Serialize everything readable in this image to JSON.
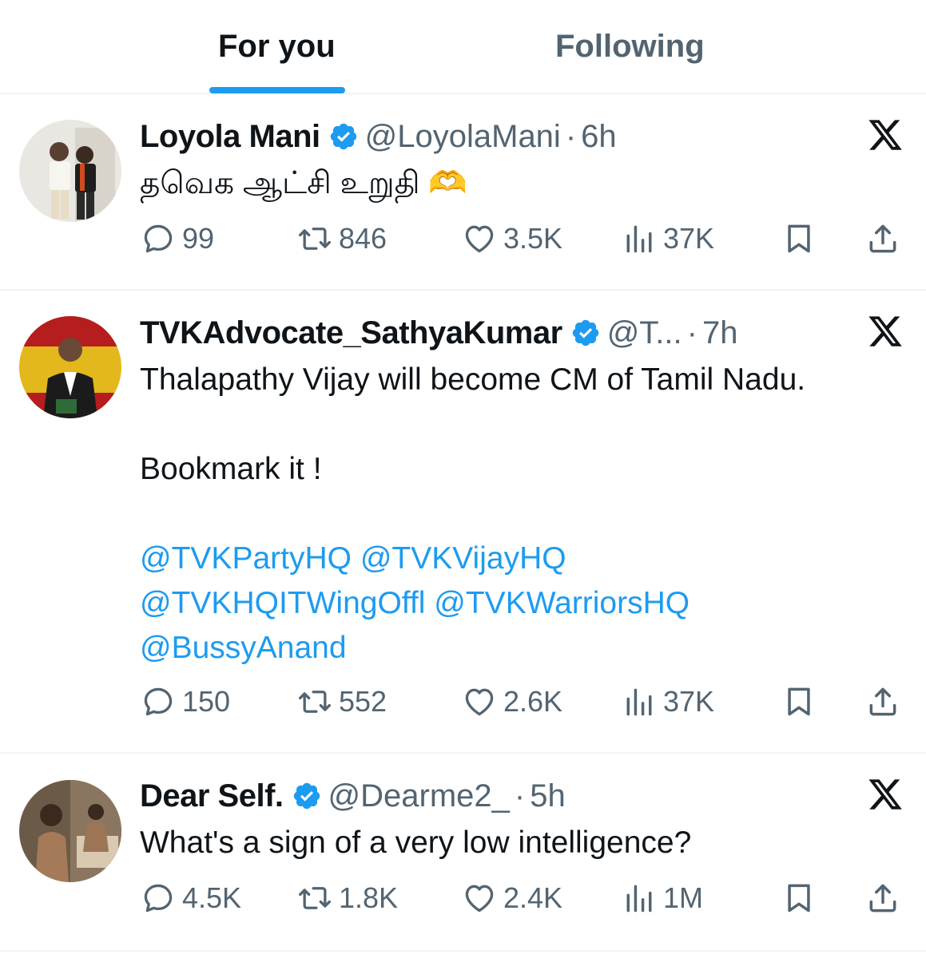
{
  "tabs": {
    "for_you": "For you",
    "following": "Following"
  },
  "colors": {
    "accent": "#1d9bf0",
    "text_primary": "#0f1419",
    "text_secondary": "#536471",
    "divider": "#eff3f4"
  },
  "tweets": [
    {
      "name": "Loyola Mani",
      "handle": "@LoyolaMani",
      "time": "6h",
      "text_lines": [
        "தவெக ஆட்சி உறுதி 🫶"
      ],
      "reply_count": "99",
      "retweet_count": "846",
      "like_count": "3.5K",
      "view_count": "37K"
    },
    {
      "name": "TVKAdvocate_SathyaKumar",
      "handle": "@T...",
      "time": "7h",
      "text_lines": [
        "Thalapathy Vijay will become CM of Tamil Nadu.",
        "Bookmark it !"
      ],
      "mentions": [
        "@TVKPartyHQ",
        "@TVKVijayHQ",
        "@TVKHQITWingOffl",
        "@TVKWarriorsHQ",
        "@BussyAnand"
      ],
      "reply_count": "150",
      "retweet_count": "552",
      "like_count": "2.6K",
      "view_count": "37K"
    },
    {
      "name": "Dear Self.",
      "handle": "@Dearme2_",
      "time": "5h",
      "text_lines": [
        "What's a sign of a very low intelligence?"
      ],
      "reply_count": "4.5K",
      "retweet_count": "1.8K",
      "like_count": "2.4K",
      "view_count": "1M"
    }
  ],
  "icons": {
    "verified": "verified-badge-icon",
    "x_logo": "x-logo-icon",
    "reply": "reply-icon",
    "retweet": "retweet-icon",
    "like": "heart-icon",
    "views": "views-chart-icon",
    "bookmark": "bookmark-icon",
    "share": "share-icon"
  }
}
